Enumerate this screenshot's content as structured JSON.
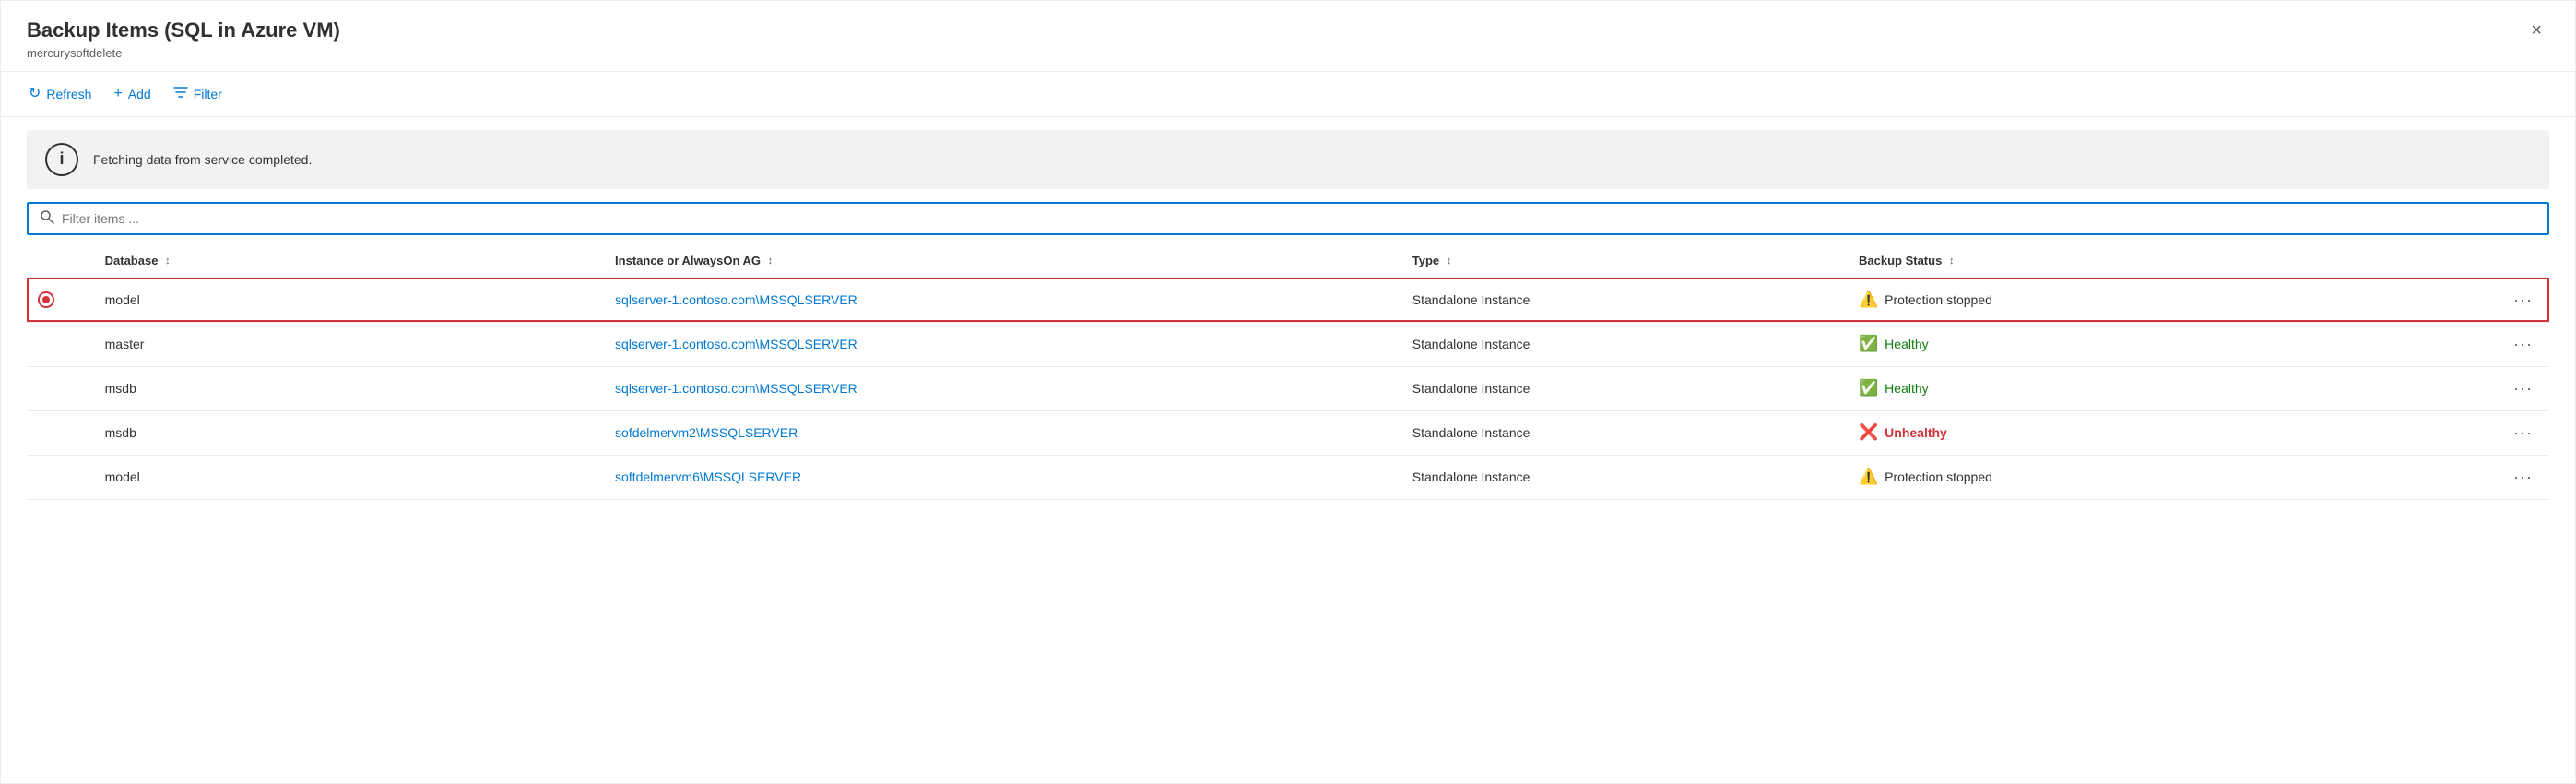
{
  "panel": {
    "title": "Backup Items (SQL in Azure VM)",
    "subtitle": "mercurysoftdelete",
    "close_label": "×"
  },
  "toolbar": {
    "refresh_label": "Refresh",
    "add_label": "Add",
    "filter_label": "Filter"
  },
  "info_bar": {
    "message": "Fetching data from service completed."
  },
  "search": {
    "placeholder": "Filter items ..."
  },
  "table": {
    "columns": [
      {
        "id": "db",
        "label": "Database"
      },
      {
        "id": "instance",
        "label": "Instance or AlwaysOn AG"
      },
      {
        "id": "type",
        "label": "Type"
      },
      {
        "id": "status",
        "label": "Backup Status"
      }
    ],
    "rows": [
      {
        "id": 1,
        "selected": true,
        "db": "model",
        "instance": "sqlserver-1.contoso.com\\MSSQLSERVER",
        "type": "Standalone Instance",
        "status_type": "protection-stopped",
        "status_label": "Protection stopped"
      },
      {
        "id": 2,
        "selected": false,
        "db": "master",
        "instance": "sqlserver-1.contoso.com\\MSSQLSERVER",
        "type": "Standalone Instance",
        "status_type": "healthy",
        "status_label": "Healthy"
      },
      {
        "id": 3,
        "selected": false,
        "db": "msdb",
        "instance": "sqlserver-1.contoso.com\\MSSQLSERVER",
        "type": "Standalone Instance",
        "status_type": "healthy",
        "status_label": "Healthy"
      },
      {
        "id": 4,
        "selected": false,
        "db": "msdb",
        "instance": "sofdelmervm2\\MSSQLSERVER",
        "type": "Standalone Instance",
        "status_type": "unhealthy",
        "status_label": "Unhealthy"
      },
      {
        "id": 5,
        "selected": false,
        "db": "model",
        "instance": "softdelmervm6\\MSSQLSERVER",
        "type": "Standalone Instance",
        "status_type": "protection-stopped",
        "status_label": "Protection stopped"
      }
    ]
  }
}
